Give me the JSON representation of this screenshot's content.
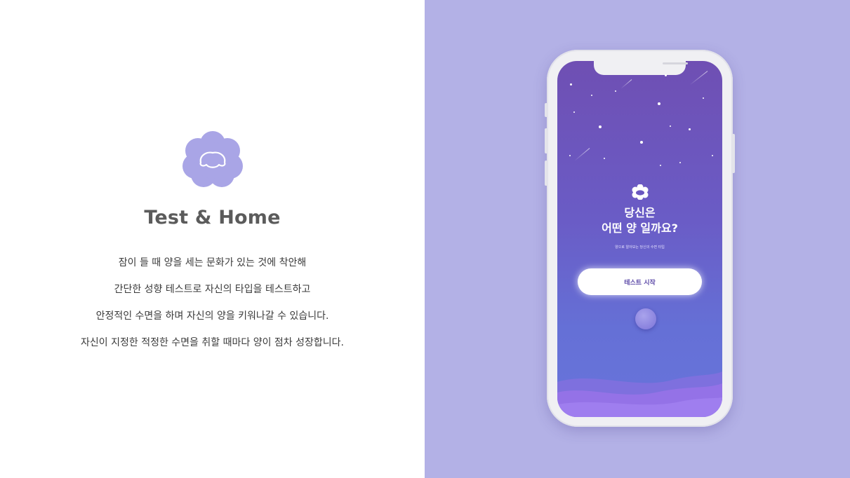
{
  "left": {
    "logo_icon": "sheep-face-icon",
    "title": "Test & Home",
    "description": [
      "잠이 들 때 양을 세는 문화가 있는 것에 착안해",
      "간단한 성향 테스트로 자신의 타입을 테스트하고",
      "안정적인 수면을 하며 자신의 양을 키워나갈 수 있습니다.",
      "자신이 지정한 적정한 수면을 취할 때마다 양이 점차 성장합니다."
    ]
  },
  "phone": {
    "icon": "sheep-icon",
    "title_line1": "당신은",
    "title_line2": "어떤 양 일까요?",
    "subtitle": "양으로 알아보는 당신의 수면 타입",
    "start_button": "테스트 시작",
    "circle_button_icon": "circle-icon"
  },
  "colors": {
    "accent": "#b3b1e6",
    "logo": "#a9a5e6",
    "screen_top": "#6f4fb3",
    "screen_bottom": "#6874db",
    "button_text": "#5d4aa8"
  }
}
